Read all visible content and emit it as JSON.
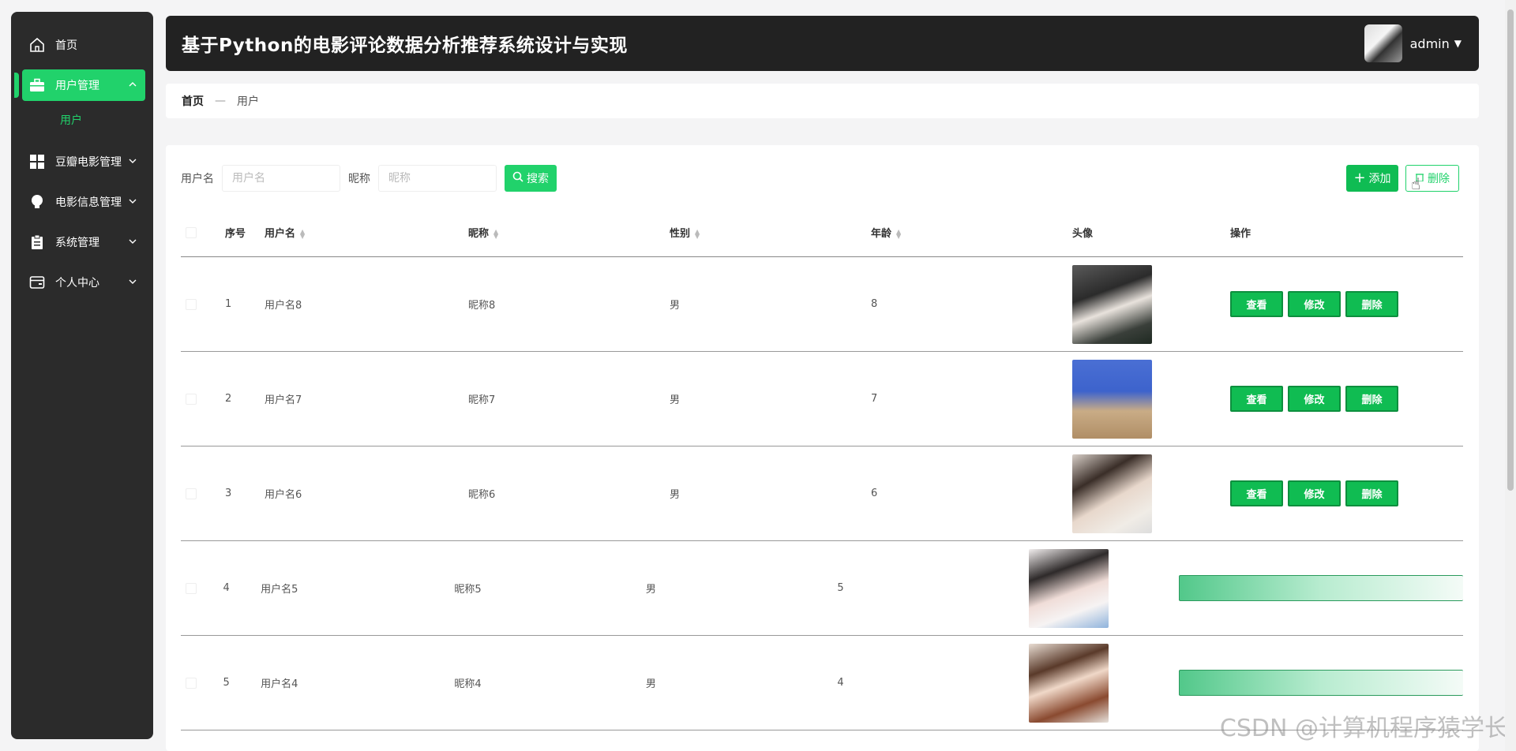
{
  "sidebar": {
    "items": [
      {
        "label": "首页",
        "icon": "home-icon"
      },
      {
        "label": "用户管理",
        "icon": "briefcase-icon",
        "active": true
      },
      {
        "label": "豆瓣电影管理",
        "icon": "grid-icon"
      },
      {
        "label": "电影信息管理",
        "icon": "bulb-icon"
      },
      {
        "label": "系统管理",
        "icon": "clipboard-icon"
      },
      {
        "label": "个人中心",
        "icon": "wallet-icon"
      }
    ],
    "sub_item": "用户",
    "accent": "#21d26b"
  },
  "header": {
    "title": "基于Python的电影评论数据分析推荐系统设计与实现",
    "username": "admin"
  },
  "breadcrumb": {
    "home": "首页",
    "sep": "—",
    "current": "用户"
  },
  "search": {
    "username_label": "用户名",
    "username_placeholder": "用户名",
    "nickname_label": "昵称",
    "nickname_placeholder": "昵称",
    "search_button": "搜索",
    "add_button": "添加",
    "delete_button": "删除"
  },
  "table": {
    "headers": {
      "index": "序号",
      "username": "用户名",
      "nickname": "昵称",
      "sex": "性别",
      "age": "年龄",
      "avatar": "头像",
      "ops": "操作"
    },
    "rows": [
      {
        "index": "1",
        "username": "用户名8",
        "nickname": "昵称8",
        "sex": "男",
        "age": "8"
      },
      {
        "index": "2",
        "username": "用户名7",
        "nickname": "昵称7",
        "sex": "男",
        "age": "7"
      },
      {
        "index": "3",
        "username": "用户名6",
        "nickname": "昵称6",
        "sex": "男",
        "age": "6"
      },
      {
        "index": "4",
        "username": "用户名5",
        "nickname": "昵称5",
        "sex": "男",
        "age": "5"
      },
      {
        "index": "5",
        "username": "用户名4",
        "nickname": "昵称4",
        "sex": "男",
        "age": "4"
      }
    ],
    "op_labels": {
      "view": "查看",
      "edit": "修改",
      "delete": "删除"
    }
  },
  "watermark": "CSDN @计算机程序猿学长"
}
